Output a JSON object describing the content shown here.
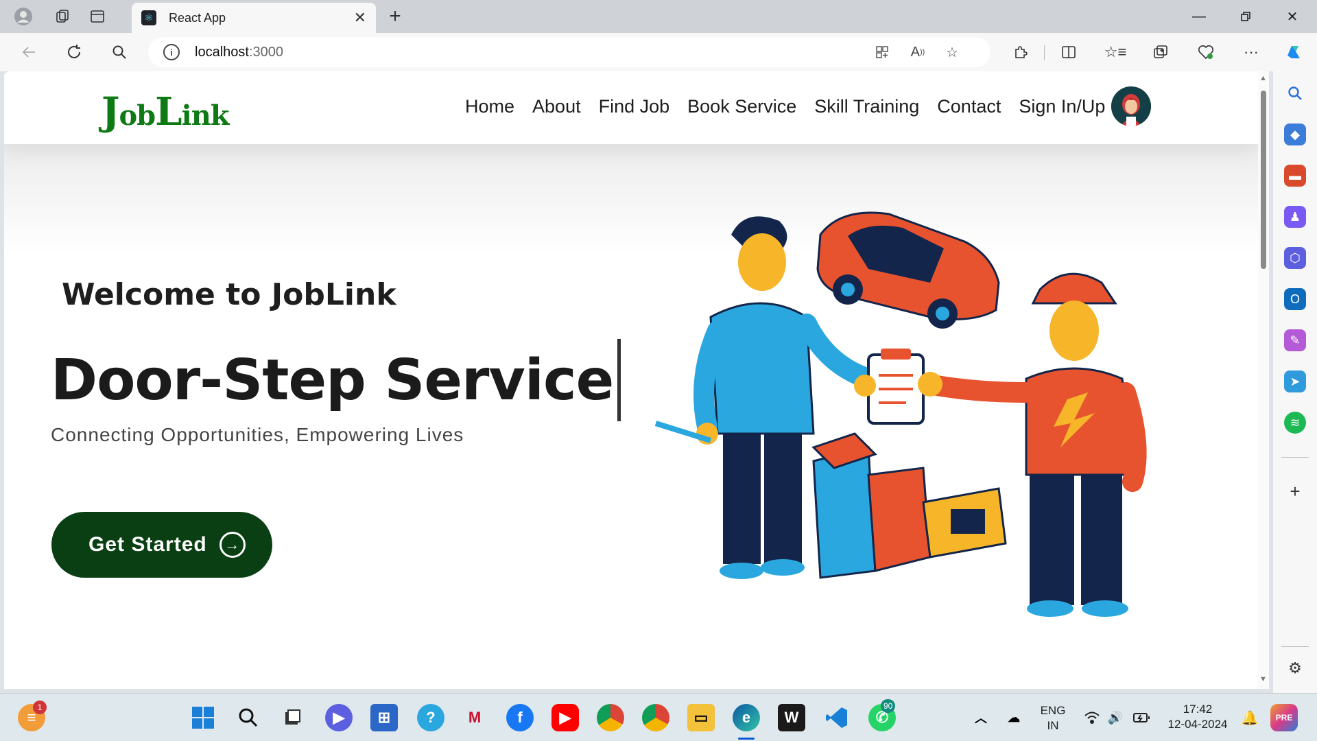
{
  "browser": {
    "tab_title": "React App",
    "url_host": "localhost",
    "url_port": ":3000"
  },
  "site": {
    "logo_first": "J",
    "logo_mid": "ob",
    "logo_second": "L",
    "logo_end": "ink",
    "nav": [
      "Home",
      "About",
      "Find Job",
      "Book Service",
      "Skill Training",
      "Contact",
      "Sign In/Up"
    ],
    "welcome": "Welcome to JobLink",
    "headline": "Door-Step Service",
    "tagline": "Connecting Opportunities, Empowering Lives",
    "cta_label": "Get Started"
  },
  "taskbar": {
    "widget_badge": "1",
    "whatsapp_badge": "90",
    "lang_line1": "ENG",
    "lang_line2": "IN",
    "time": "17:42",
    "date": "12-04-2024"
  },
  "colors": {
    "brand_green": "#0e7a14",
    "cta_bg": "#093f12",
    "illustration_orange": "#e8532f",
    "illustration_blue": "#2aa7df",
    "illustration_navy": "#13254a",
    "illustration_yellow": "#f7b52a"
  }
}
